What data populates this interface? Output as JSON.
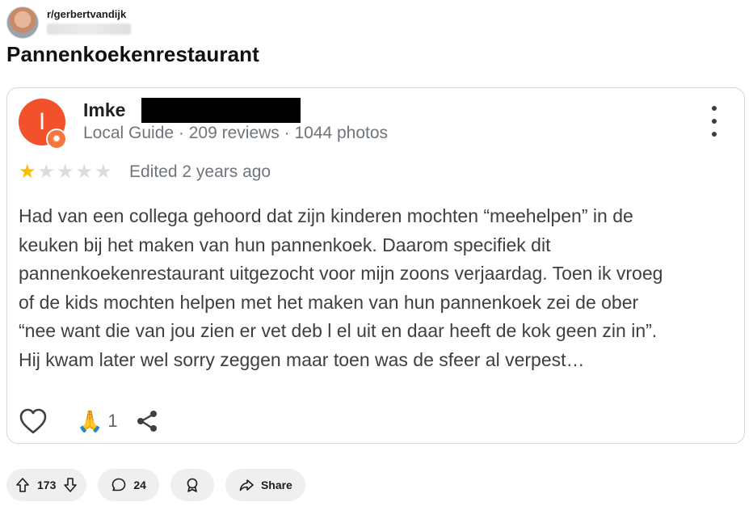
{
  "post": {
    "subreddit": "r/gerbertvandijk",
    "title": "Pannenkoekenrestaurant"
  },
  "review": {
    "avatar_letter": "I",
    "reviewer_name": "Imke",
    "reviewer_meta": "Local Guide · 209 reviews · 1044 photos",
    "rating": 1,
    "rating_max": 5,
    "edited": "Edited 2 years ago",
    "text": "Had van een collega gehoord dat zijn kinderen mochten “meehelpen” in de\nkeuken bij het maken van hun pannenkoek. Daarom specifiek dit\npannenkoekenrestaurant uitgezocht voor mijn zoons verjaardag. Toen ik vroeg\nof de kids mochten helpen met het maken van hun pannenkoek zei de ober\n“nee want die van jou zien er vet deb l el uit en daar heeft de kok geen zin in”.\nHij kwam later wel sorry zeggen maar toen was de sfeer al verpest…",
    "reaction_count": "1",
    "icons": {
      "like": "heart-icon",
      "reaction": "praying-hands-icon",
      "share": "share-icon",
      "menu": "more-vertical-icon",
      "badge": "local-guide-badge-icon"
    },
    "accent": "#f3512b"
  },
  "actions": {
    "upvotes": "173",
    "comments": "24",
    "share_label": "Share"
  }
}
